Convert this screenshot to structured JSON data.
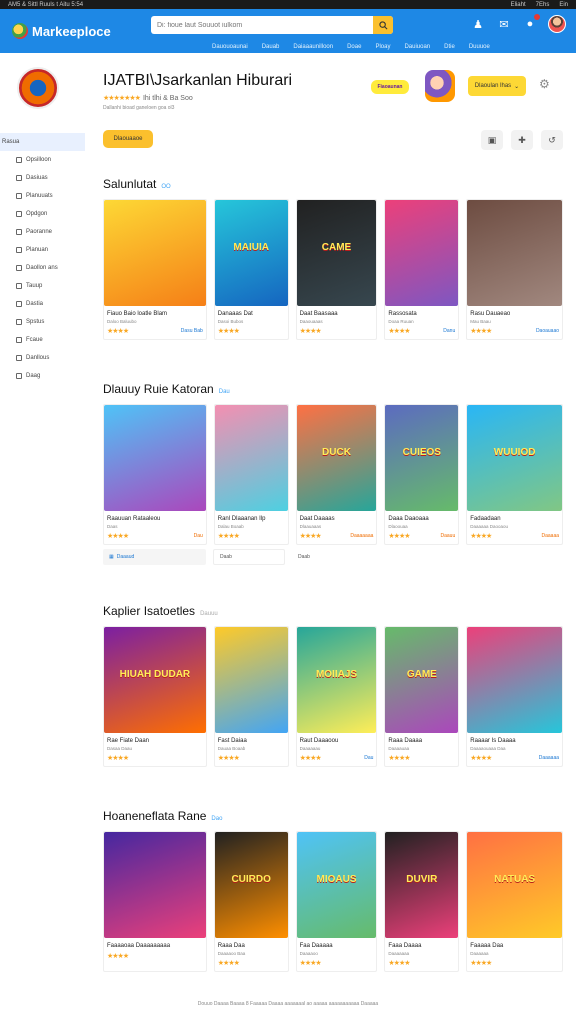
{
  "status_bar": {
    "left": "AM5 & Sittl Ruuls t Aitu 5:54",
    "right_items": [
      "Eliaht",
      "7Ehs",
      "Ein"
    ]
  },
  "header": {
    "brand": "Markeeploce",
    "search_placeholder": "Di: fioue laut Souuot iulkom",
    "nav": [
      "Dauouoaunai",
      "Dauab",
      "Daiaaaunilloon",
      "Doae",
      "Ploay",
      "Dauiuoan",
      "Dtie",
      "Duuuoe"
    ]
  },
  "sidebar": {
    "items": [
      "Rasua",
      "Opsilloon",
      "Dasiuas",
      "Planuuats",
      "Opdgon",
      "Paoranne",
      "Planuan",
      "Daollon ans",
      "Tauup",
      "Dastia",
      "Spstus",
      "Fcaue",
      "Danllous",
      "Daag"
    ]
  },
  "app": {
    "title": "IJATBI\\Jsarkanlan Hiburari",
    "rating_text": "Ihi tlhi & Ba Soo",
    "subtitle": "Dallanhi bioad ganeloen goa ol3",
    "promo_badge": "Fiaoaunan",
    "cta_label": "Dlaoulan lhas",
    "install_label": "Dlaouaaoe"
  },
  "sections": [
    {
      "title": "Salunlutat",
      "see_all": "OO",
      "cards": [
        {
          "name": "Fiauo Baio loatle Blam",
          "sub": "Daloo Baluubo",
          "price": "Dasu Bab",
          "word": "",
          "colors": [
            "#fdd835",
            "#f57f17"
          ]
        },
        {
          "name": "Danaaas Dat",
          "sub": "Dasoi Bubos",
          "price": "",
          "word": "MAIUIA",
          "colors": [
            "#26c6da",
            "#1565c0"
          ]
        },
        {
          "name": "Daat Baasaaa",
          "sub": "Daaouaaas",
          "price": "",
          "word": "CAME",
          "colors": [
            "#212121",
            "#37474f"
          ]
        },
        {
          "name": "Rassosata",
          "sub": "Doaa Ruuan",
          "price": "Danu",
          "word": "",
          "colors": [
            "#ec407a",
            "#7e57c2"
          ]
        },
        {
          "name": "Rasu Dauaeao",
          "sub": "Mau Baau",
          "price": "Daoauaao",
          "word": "",
          "colors": [
            "#6d4c41",
            "#a1887f"
          ]
        }
      ]
    },
    {
      "title": "Dlauuy Ruie Katoran",
      "see_all": "Dau",
      "cards": [
        {
          "name": "Raauuan Rataaleou",
          "sub": "Daas",
          "price": "Dau",
          "word": "",
          "colors": [
            "#4fc3f7",
            "#ab47bc"
          ]
        },
        {
          "name": "Ranl Dlaaanan Ilp",
          "sub": "Dalau Boaab",
          "price": "",
          "word": "",
          "colors": [
            "#f48fb1",
            "#4dd0e1"
          ]
        },
        {
          "name": "Daat Daaaas",
          "sub": "Dlaauaaas",
          "price": "Daaaaaaa",
          "word": "DUCK",
          "colors": [
            "#ff7043",
            "#26a69a"
          ]
        },
        {
          "name": "Daaa Daaoaaa",
          "sub": "Dlaoouaa",
          "price": "Daauu",
          "word": "CUIEOS",
          "colors": [
            "#5c6bc0",
            "#66bb6a"
          ]
        },
        {
          "name": "Fadaadaan",
          "sub": "Daaaaaa Daooaou",
          "price": "Daaaaa",
          "word": "WUUIOD",
          "colors": [
            "#29b6f6",
            "#81c784"
          ]
        }
      ],
      "chips": [
        "Daaaud",
        "Daab",
        "Daab"
      ]
    },
    {
      "title": "Kaplier Isatoetles",
      "see_all": "Dauuu",
      "cards": [
        {
          "name": "Rae Fiate Daan",
          "sub": "Dasaa Daau",
          "price": "",
          "word": "HIUAH DUDAR",
          "colors": [
            "#7b1fa2",
            "#ff6f00"
          ]
        },
        {
          "name": "Fast Daiaa",
          "sub": "Dauaa Boaab",
          "price": "",
          "word": "",
          "colors": [
            "#ffca28",
            "#42a5f5"
          ]
        },
        {
          "name": "Raut Daaaoou",
          "sub": "Daaaaaau",
          "price": "Dau",
          "word": "MOIIAJS",
          "colors": [
            "#26a69a",
            "#ffee58"
          ]
        },
        {
          "name": "Raaa Daaaa",
          "sub": "Daaaauaa",
          "price": "",
          "word": "GAME",
          "colors": [
            "#66bb6a",
            "#ab47bc"
          ]
        },
        {
          "name": "Raaaar Is Daaaa",
          "sub": "Daaaaouaaa Daa",
          "price": "Daaaaaa",
          "word": "",
          "colors": [
            "#ec407a",
            "#26c6da"
          ]
        }
      ]
    },
    {
      "title": "Hoaneneflata Rane",
      "see_all": "Dao",
      "cards": [
        {
          "name": "Faaaaoaa Daaaaaaaaa",
          "sub": "",
          "price": "",
          "word": "",
          "colors": [
            "#4527a0",
            "#ec407a"
          ]
        },
        {
          "name": "Raaa Daa",
          "sub": "Daaaaoo Baa",
          "price": "",
          "word": "CUIRDO",
          "colors": [
            "#212121",
            "#ff8f00"
          ]
        },
        {
          "name": "Faa Daaaaa",
          "sub": "Daaaaoo",
          "price": "",
          "word": "MIOAUS",
          "colors": [
            "#4fc3f7",
            "#66bb6a"
          ]
        },
        {
          "name": "Faaa Daaaa",
          "sub": "Daaaaaaa",
          "price": "",
          "word": "DUVIR",
          "colors": [
            "#212121",
            "#ec407a"
          ]
        },
        {
          "name": "Faaaaa Daa",
          "sub": "Daaaaaa",
          "price": "",
          "word": "NATUAS",
          "colors": [
            "#ff7043",
            "#ffca28"
          ]
        }
      ]
    }
  ],
  "footer": "Douuo Daaaa Baaaa 8 Faaaaa Daaaa aaaaaaal ao aaaaa aaaaaaaaaaa Daaaaa"
}
